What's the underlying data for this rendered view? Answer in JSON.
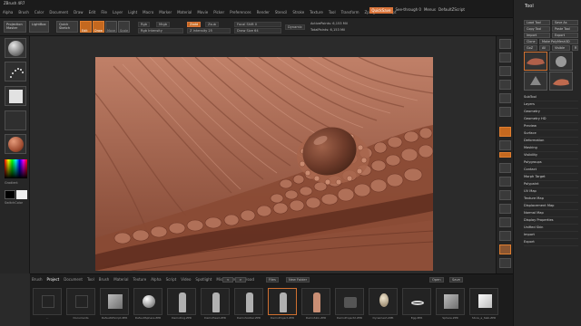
{
  "app": {
    "title": "ZBrush 4R7"
  },
  "menu": {
    "items": [
      "Alpha",
      "Brush",
      "Color",
      "Document",
      "Draw",
      "Edit",
      "File",
      "Layer",
      "Light",
      "Macro",
      "Marker",
      "Material",
      "Movie",
      "Picker",
      "Preferences",
      "Render",
      "Stencil",
      "Stroke",
      "Texture",
      "Tool",
      "Transform",
      "Zplugin",
      "Zscript"
    ],
    "quicksave": "QuickSave",
    "see_through": "See-through 0",
    "menus": "Menus",
    "default_zscript": "DefaultZScript"
  },
  "shelf": {
    "projection_master": "Projection Master",
    "lightbox": "LightBox",
    "quick_sketch": "Quick Sketch",
    "edit": "Edit",
    "draw": "Draw",
    "move": "Move",
    "scale": "Scale",
    "rotate": "Rotate",
    "rgb": "Rgb",
    "mrgb": "Mrgb",
    "m": "M",
    "zadd": "Zadd",
    "zsub": "Zsub",
    "zcut": "Zcut",
    "rgb_intensity": "Rgb Intensity",
    "z_intensity": "Z Intensity 25",
    "focal_shift": "Focal Shift 0",
    "draw_size": "Draw Size 64",
    "dynamic": "Dynamic",
    "active_points": "ActivePoints: 6,153 Mil",
    "total_points": "TotalPoints: 6,153 Mil"
  },
  "left_tray": {
    "gradient": "Gradient",
    "switch_color": "SwitchColor",
    "alternate": "Alternate"
  },
  "right_tray": {
    "title": "Tool",
    "buttons": [
      "Load Tool",
      "Save As",
      "Copy Tool",
      "Paste Tool",
      "Import",
      "Export",
      "Clone",
      "Make PolyMesh3D",
      "GoZ",
      "All",
      "Visible",
      "R"
    ],
    "lightbox_tools": "Lightbox› Tools",
    "current_tool": "Stun_10_58",
    "tool_count": "R",
    "thumbs": [
      "Stun_10",
      "PM3D_Sphere",
      "SimpleBrush",
      "Stun_10_58"
    ],
    "subpanels": [
      "SubTool",
      "Layers",
      "Geometry",
      "Geometry HD",
      "Preview",
      "Surface",
      "Deformation",
      "Masking",
      "Visibility",
      "Polygroups",
      "Contact",
      "Morph Target",
      "Polypaint",
      "UV Map",
      "Texture Map",
      "Displacement Map",
      "Normal Map",
      "Display Properties",
      "Unified Skin",
      "Import",
      "Export"
    ]
  },
  "bottom": {
    "tabs": [
      "Brush",
      "Project",
      "Document",
      "Tool",
      "Brush",
      "Material",
      "Texture",
      "Alpha",
      "Script",
      "Video",
      "Spotlight",
      "Misc",
      "Web",
      "Upload"
    ],
    "active_tab": "Project",
    "nav_prev": "<",
    "nav_next": ">",
    "path": "Files",
    "new_folder": "New Folder",
    "open": "Open",
    "save": "Save",
    "items": [
      {
        "label": "...",
        "icon": "folder"
      },
      {
        "label": "Documents",
        "icon": "folder"
      },
      {
        "label": "DefaultZScript.ZPR",
        "icon": "cube"
      },
      {
        "label": "DefaultSphere.ZPR",
        "icon": "ball"
      },
      {
        "label": "DemoDog.ZPR",
        "icon": "fig"
      },
      {
        "label": "DemoHead.ZPR",
        "icon": "fig"
      },
      {
        "label": "DemoSoldier.ZPR",
        "icon": "fig"
      },
      {
        "label": "DemoProject.ZPR",
        "icon": "fig"
      },
      {
        "label": "DemoSkin.ZPR",
        "icon": "tan"
      },
      {
        "label": "DemoProject2.ZPR",
        "icon": "cyl"
      },
      {
        "label": "Dynamesh.ZPR",
        "icon": "egg"
      },
      {
        "label": "Egg.ZPR",
        "icon": "ring"
      },
      {
        "label": "Sphere.ZPR",
        "icon": "cube"
      },
      {
        "label": "Store_a_Slab.ZPR",
        "icon": "whitecube"
      },
      {
        "label": "Mannequin.ZPR",
        "icon": "tan"
      }
    ]
  },
  "colors": {
    "accent": "#d9743a",
    "clay": "#9b5c45",
    "bg": "#2a2a2a"
  }
}
